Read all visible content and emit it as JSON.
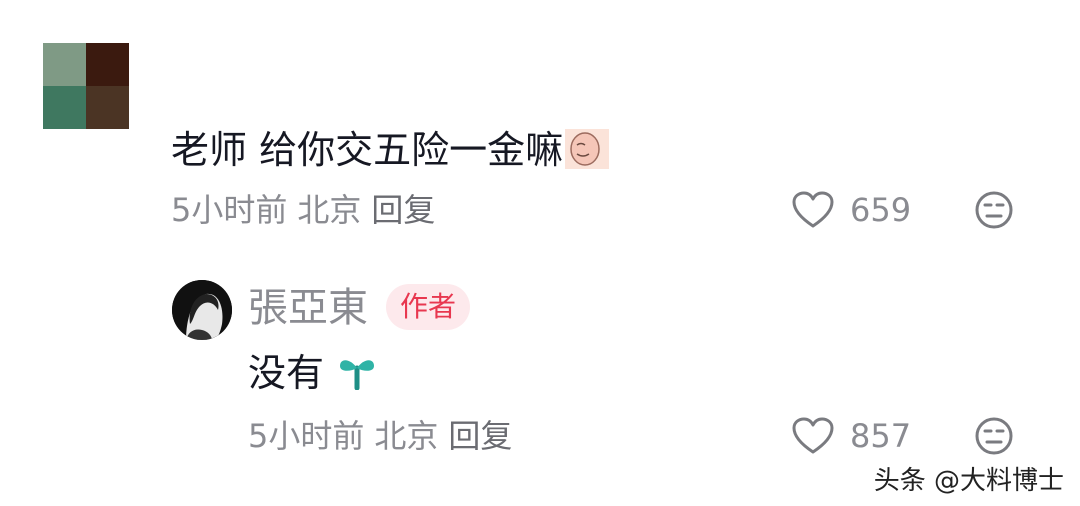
{
  "comment": {
    "text": "老师 给你交五险一金嘛",
    "emoji_icon": "grimace-emoji-icon",
    "time": "5小时前",
    "location": "北京",
    "reply_label": "回复",
    "like_count": "659"
  },
  "reply": {
    "author_name": "張亞東",
    "author_badge": "作者",
    "text": "没有",
    "emoji_icon": "sprout-emoji-icon",
    "time": "5小时前",
    "location": "北京",
    "reply_label": "回复",
    "like_count": "857"
  },
  "watermark": "头条 @大料博士",
  "colors": {
    "text_primary": "#161823",
    "text_secondary": "#8a8b91",
    "badge_bg": "#fde9ec",
    "badge_text": "#e8374f"
  }
}
